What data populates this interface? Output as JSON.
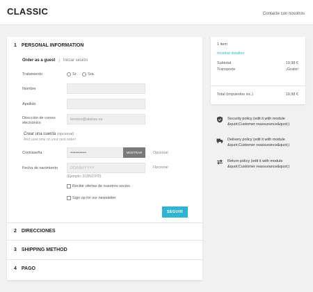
{
  "header": {
    "logo": "CLASSIC",
    "contact_link": "Contacte con nosotros"
  },
  "steps": [
    {
      "num": "1",
      "title": "PERSONAL INFORMATION"
    },
    {
      "num": "2",
      "title": "DIRECCIONES"
    },
    {
      "num": "3",
      "title": "SHIPPING METHOD"
    },
    {
      "num": "4",
      "title": "PAGO"
    }
  ],
  "personal": {
    "tab_guest": "Order as a guest",
    "tab_divider": "|",
    "tab_login": "Iniciar sesión",
    "title_label": "Tratamiento",
    "radio_mr": "Sr.",
    "radio_mrs": "Sra.",
    "name_label": "Nombre",
    "surname_label": "Apellido",
    "email_label": "Dirección de correo electrónico",
    "email_value": "tecnico@alabaz.es",
    "create_account": "Crear una cuenta",
    "optional_paren": "(opcional)",
    "create_account_sub": "And save time on your next order!",
    "password_label": "Contraseña",
    "password_value": "••••••••••••",
    "show_button": "MOSTRAR",
    "optional": "Opcional",
    "birthdate_label": "Fecha de nacimiento",
    "birthdate_placeholder": "DD/MM/YYYY",
    "birthdate_hint": "(Ejemplo: 31/05/1970)",
    "offers_checkbox": "Recibir ofertas de nuestros socios",
    "newsletter_checkbox": "Sign up for our newsletter",
    "continue_button": "SEGUIR"
  },
  "cart": {
    "items": "1 item",
    "show_details": "mostrar detalles",
    "subtotal_label": "Subtotal",
    "subtotal_value": "19,98 €",
    "shipping_label": "Transporte",
    "shipping_value": "¡Gratis!",
    "total_label": "Total (impuestos inc.)",
    "total_value": "19,98 €"
  },
  "reassurance": [
    {
      "icon": "shield-icon",
      "text": "Security policy (edit it with module &quot;Customer reassurance&quot;)"
    },
    {
      "icon": "truck-icon",
      "text": "Delivery policy (edit it with module &quot;Customer reassurance&quot;)"
    },
    {
      "icon": "arrows-icon",
      "text": "Return policy (edit it with module &quot;Customer reassurance&quot;)"
    }
  ],
  "colors": {
    "accent": "#2fb5d2",
    "background": "#f1f1f1",
    "input_bg": "#efefef"
  }
}
